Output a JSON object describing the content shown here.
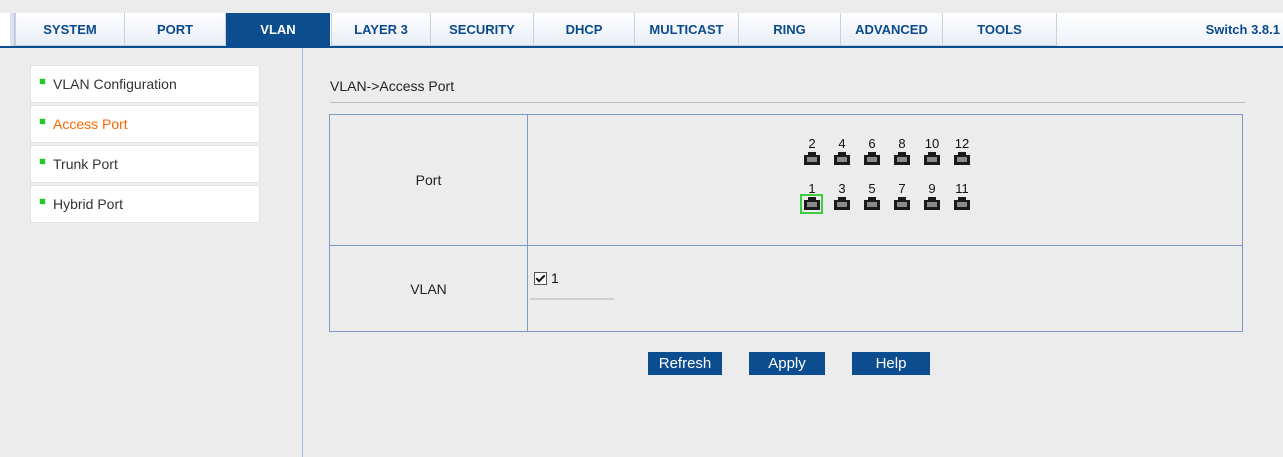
{
  "nav": {
    "tabs": [
      {
        "label": "SYSTEM",
        "active": false
      },
      {
        "label": "PORT",
        "active": false
      },
      {
        "label": "VLAN",
        "active": true
      },
      {
        "label": "LAYER 3",
        "active": false
      },
      {
        "label": "SECURITY",
        "active": false
      },
      {
        "label": "DHCP",
        "active": false
      },
      {
        "label": "MULTICAST",
        "active": false
      },
      {
        "label": "RING",
        "active": false
      },
      {
        "label": "ADVANCED",
        "active": false
      },
      {
        "label": "TOOLS",
        "active": false
      }
    ],
    "version": "Switch 3.8.1"
  },
  "sidebar": {
    "items": [
      {
        "label": "VLAN Configuration",
        "active": false
      },
      {
        "label": "Access Port",
        "active": true
      },
      {
        "label": "Trunk Port",
        "active": false
      },
      {
        "label": "Hybrid Port",
        "active": false
      }
    ]
  },
  "main": {
    "breadcrumb": "VLAN->Access Port",
    "port_label": "Port",
    "vlan_label": "VLAN",
    "ports_top": [
      "2",
      "4",
      "6",
      "8",
      "10",
      "12"
    ],
    "ports_bottom": [
      "1",
      "3",
      "5",
      "7",
      "9",
      "11"
    ],
    "selected_port": "1",
    "vlan_option": {
      "label": "1",
      "checked": true
    }
  },
  "buttons": {
    "refresh": "Refresh",
    "apply": "Apply",
    "help": "Help"
  },
  "colors": {
    "accent": "#0b4d8e",
    "active_sidebar": "#ff6600",
    "port_selected": "#3ccc3c"
  }
}
